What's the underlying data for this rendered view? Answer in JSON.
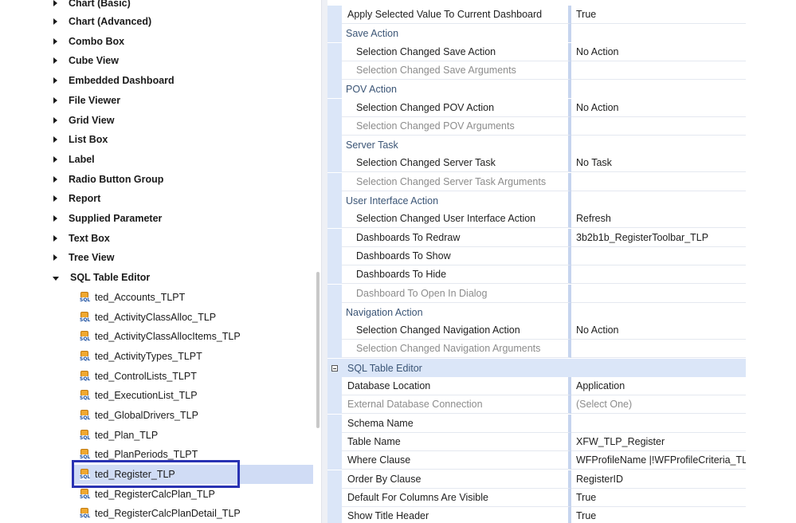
{
  "tree": {
    "categories": [
      {
        "label": "Chart (Basic)"
      },
      {
        "label": "Chart (Advanced)"
      },
      {
        "label": "Combo Box"
      },
      {
        "label": "Cube View"
      },
      {
        "label": "Embedded Dashboard"
      },
      {
        "label": "File Viewer"
      },
      {
        "label": "Grid View"
      },
      {
        "label": "List Box"
      },
      {
        "label": "Label"
      },
      {
        "label": "Radio Button Group"
      },
      {
        "label": "Report"
      },
      {
        "label": "Supplied Parameter"
      },
      {
        "label": "Text Box"
      },
      {
        "label": "Tree View"
      },
      {
        "label": "SQL Table Editor"
      }
    ],
    "children": [
      {
        "label": "ted_Accounts_TLPT"
      },
      {
        "label": "ted_ActivityClassAlloc_TLP"
      },
      {
        "label": "ted_ActivityClassAllocItems_TLP"
      },
      {
        "label": "ted_ActivityTypes_TLPT"
      },
      {
        "label": "ted_ControlLists_TLPT"
      },
      {
        "label": "ted_ExecutionList_TLP"
      },
      {
        "label": "ted_GlobalDrivers_TLP"
      },
      {
        "label": "ted_Plan_TLP"
      },
      {
        "label": "ted_PlanPeriods_TLPT"
      },
      {
        "label": "ted_Register_TLP"
      },
      {
        "label": "ted_RegisterCalcPlan_TLP"
      },
      {
        "label": "ted_RegisterCalcPlanDetail_TLP"
      }
    ],
    "selected": "ted_Register_TLP",
    "icon": "sql-table-icon",
    "icon_text": "SQL"
  },
  "properties": {
    "rows": [
      {
        "kind": "top",
        "name": "Apply Selected Value To Current Dashboard",
        "value": "True"
      },
      {
        "kind": "cat",
        "name": "Save Action",
        "value": ""
      },
      {
        "kind": "indent",
        "name": "Selection Changed Save Action",
        "value": "No Action"
      },
      {
        "kind": "indent-disabled",
        "name": "Selection Changed Save Arguments",
        "value": ""
      },
      {
        "kind": "cat",
        "name": "POV Action",
        "value": ""
      },
      {
        "kind": "indent",
        "name": "Selection Changed POV Action",
        "value": "No Action"
      },
      {
        "kind": "indent-disabled",
        "name": "Selection Changed POV Arguments",
        "value": ""
      },
      {
        "kind": "cat",
        "name": "Server Task",
        "value": ""
      },
      {
        "kind": "indent",
        "name": "Selection Changed Server Task",
        "value": "No Task"
      },
      {
        "kind": "indent-disabled",
        "name": "Selection Changed Server Task Arguments",
        "value": ""
      },
      {
        "kind": "cat",
        "name": "User Interface Action",
        "value": ""
      },
      {
        "kind": "indent",
        "name": "Selection Changed User Interface Action",
        "value": "Refresh"
      },
      {
        "kind": "indent",
        "name": "Dashboards To Redraw",
        "value": "3b2b1b_RegisterToolbar_TLP"
      },
      {
        "kind": "indent",
        "name": "Dashboards To Show",
        "value": ""
      },
      {
        "kind": "indent",
        "name": "Dashboards To Hide",
        "value": ""
      },
      {
        "kind": "indent-disabled",
        "name": "Dashboard To Open In Dialog",
        "value": ""
      },
      {
        "kind": "cat",
        "name": "Navigation Action",
        "value": ""
      },
      {
        "kind": "indent",
        "name": "Selection Changed Navigation Action",
        "value": "No Action"
      },
      {
        "kind": "indent-disabled",
        "name": "Selection Changed Navigation Arguments",
        "value": ""
      },
      {
        "kind": "section",
        "name": "SQL Table Editor",
        "value": ""
      },
      {
        "kind": "top",
        "name": "Database Location",
        "value": "Application"
      },
      {
        "kind": "top-disabled",
        "name": "External Database Connection",
        "value": "(Select One)"
      },
      {
        "kind": "top",
        "name": "Schema Name",
        "value": ""
      },
      {
        "kind": "top",
        "name": "Table Name",
        "value": "XFW_TLP_Register"
      },
      {
        "kind": "top",
        "name": "Where Clause",
        "value": "WFProfileName |!WFProfileCriteria_TLF"
      },
      {
        "kind": "top",
        "name": "Order By Clause",
        "value": "RegisterID"
      },
      {
        "kind": "top",
        "name": "Default For Columns Are Visible",
        "value": "True"
      },
      {
        "kind": "top",
        "name": "Show Title Header",
        "value": "True"
      }
    ]
  },
  "colors": {
    "selection_highlight": "#d0dcf5",
    "annotation_box": "#2a33b3",
    "category_text": "#3b5576",
    "gutter": "#dbe6f8"
  }
}
